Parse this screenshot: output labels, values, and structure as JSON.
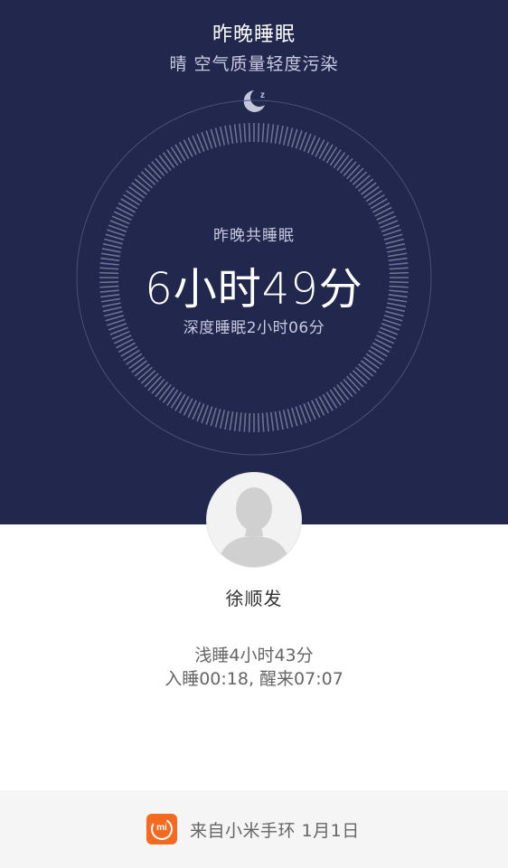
{
  "header": {
    "title": "昨晚睡眠",
    "subtitle": "晴 空气质量轻度污染",
    "icon": "moon-sleep-icon",
    "background_color": "#22274d"
  },
  "dial": {
    "label": "昨晚共睡眠",
    "value": "6小时49分",
    "deep_sleep": "深度睡眠2小时06分"
  },
  "user": {
    "name": "徐顺发",
    "avatar_icon": "default-avatar-icon"
  },
  "stats": {
    "light_sleep": "浅睡4小时43分",
    "times": "入睡00:18, 醒来07:07"
  },
  "footer": {
    "source": "来自小米手环 1月1日",
    "logo_text": "mi",
    "logo_color": "#f46a20"
  }
}
